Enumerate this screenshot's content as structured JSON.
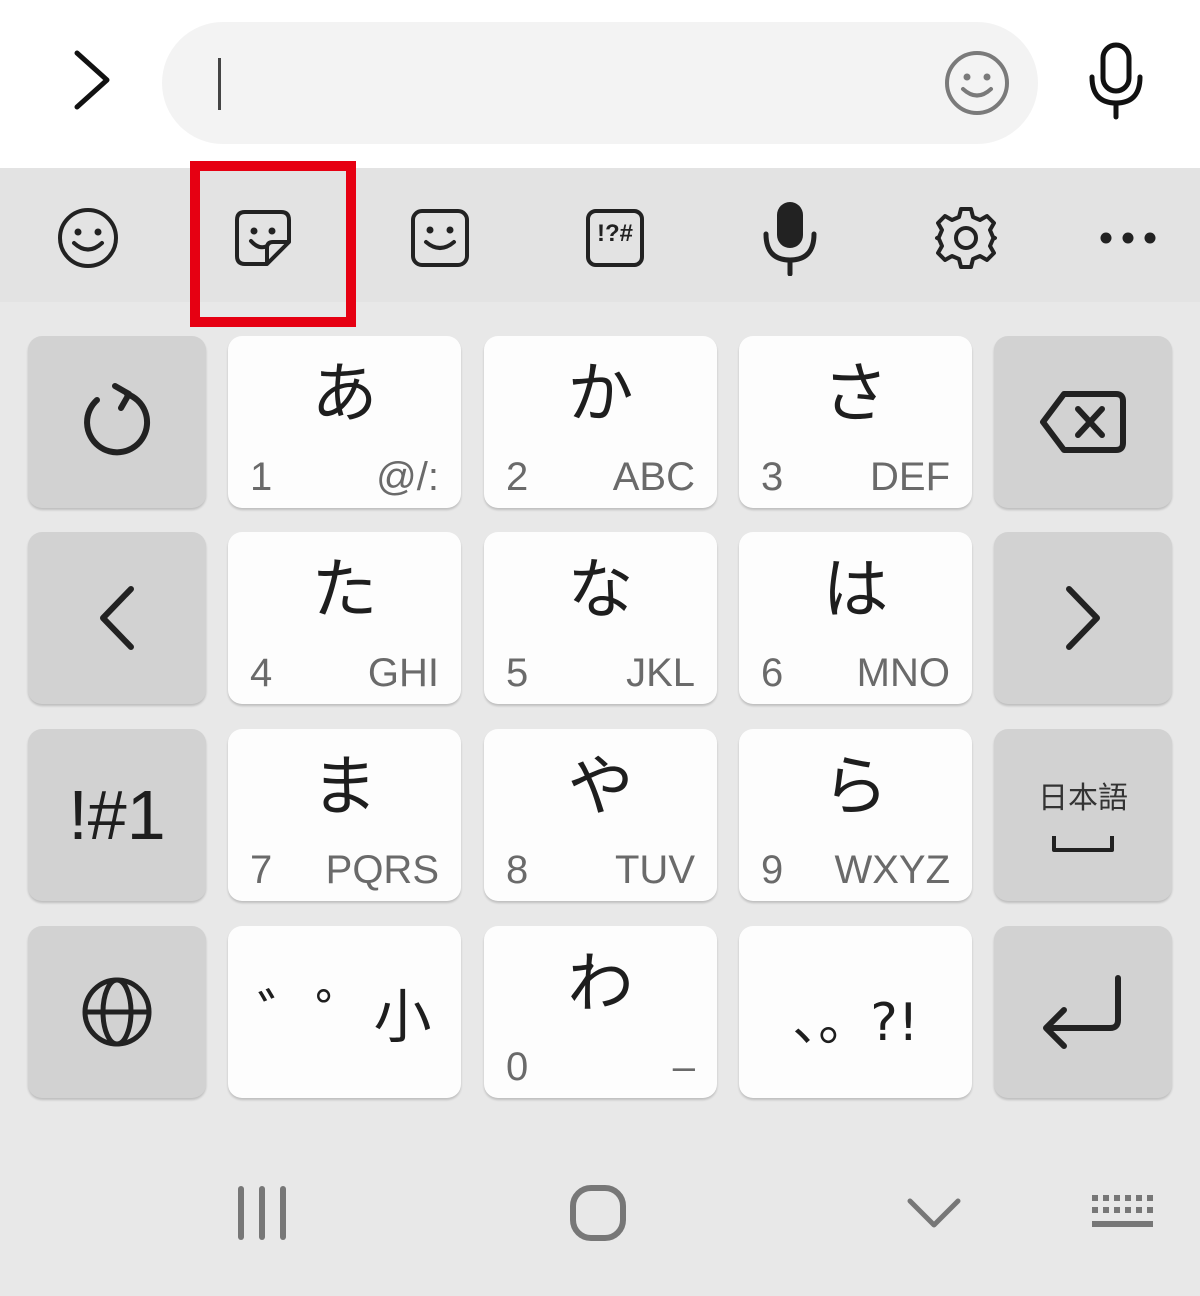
{
  "colors": {
    "highlight": "#e60012",
    "key_light": "#fdfdfd",
    "key_dark": "#d2d2d2",
    "keyboard_bg": "#e8e8e8"
  },
  "top_bar": {
    "icons": [
      "chevron-right-icon",
      "smiley-icon",
      "microphone-icon"
    ],
    "input_value": ""
  },
  "toolbar": {
    "icons": [
      "emoji-icon",
      "sticker-icon",
      "bitmoji-icon",
      "symbols-icon",
      "voice-input-icon",
      "settings-icon",
      "more-icon"
    ],
    "symbols_label": "!?#",
    "highlighted": "sticker-icon"
  },
  "keys": {
    "a": {
      "main": "あ",
      "num": "1",
      "sub": "@/:"
    },
    "ka": {
      "main": "か",
      "num": "2",
      "sub": "ABC"
    },
    "sa": {
      "main": "さ",
      "num": "3",
      "sub": "DEF"
    },
    "ta": {
      "main": "た",
      "num": "4",
      "sub": "GHI"
    },
    "na": {
      "main": "な",
      "num": "5",
      "sub": "JKL"
    },
    "ha": {
      "main": "は",
      "num": "6",
      "sub": "MNO"
    },
    "ma": {
      "main": "ま",
      "num": "7",
      "sub": "PQRS"
    },
    "ya": {
      "main": "や",
      "num": "8",
      "sub": "TUV"
    },
    "ra": {
      "main": "ら",
      "num": "9",
      "sub": "WXYZ"
    },
    "wa": {
      "main": "わ",
      "num": "0",
      "sub": "–"
    },
    "dakuten": {
      "main": "゛゜小"
    },
    "punct": {
      "main": "、。?!"
    },
    "symbol_mode": {
      "label": "!#1"
    },
    "lang_space": {
      "label": "日本語"
    }
  },
  "navbar": {
    "icons": [
      "recents-icon",
      "home-icon",
      "hide-keyboard-icon",
      "keyboard-switch-icon"
    ]
  }
}
